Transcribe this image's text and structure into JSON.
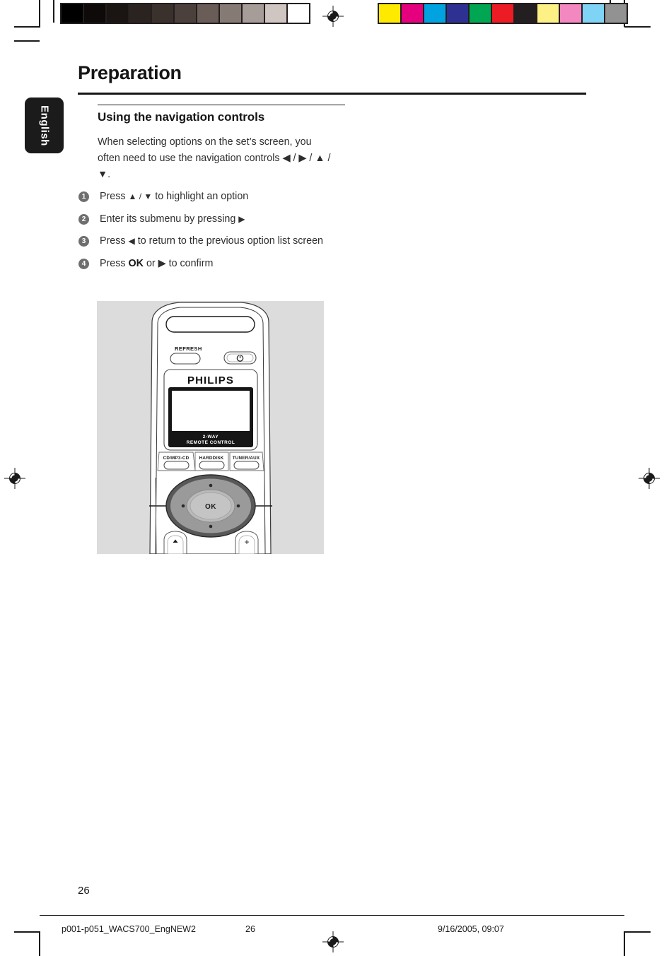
{
  "document": {
    "chapter_title": "Preparation",
    "language_tab": "English",
    "section_heading": "Using the navigation controls",
    "intro_paragraph": "When selecting options on the set’s screen, you often need to use the navigation controls ◀ / ▶ / ▲ / ▼.",
    "page_number": "26"
  },
  "steps": [
    {
      "number": "1",
      "text_before": "Press ",
      "glyphs": "▲ / ▼",
      "text_after": " to highlight an option"
    },
    {
      "number": "2",
      "text_before": "Enter its submenu by pressing ",
      "glyphs": "▶",
      "text_after": ""
    },
    {
      "number": "3",
      "text_before": "Press ",
      "glyphs": "◀",
      "text_after": " to return to the previous option list screen"
    },
    {
      "number": "4",
      "text_before": "Press ",
      "glyphs": "OK",
      "text_after": " or ▶ to confirm"
    }
  ],
  "illustration": {
    "caption_name": "two-way-remote-control",
    "brand": "PHILIPS",
    "display_label_line1": "2-WAY",
    "display_label_line2": "REMOTE CONTROL",
    "refresh_label": "REFRESH",
    "power_icon": "power-standby-icon",
    "source_buttons": [
      "CD/MP3-CD",
      "HARDDISK",
      "TUNER/AUX"
    ],
    "ok_label": "OK",
    "bottom_left_icon": "eject-icon",
    "bottom_right_label": "+",
    "panel_color": "#dcdcdc"
  },
  "footer": {
    "file_name": "p001-p051_WACS700_EngNEW2",
    "page": "26",
    "date_time": "9/16/2005, 09:07"
  },
  "calibration": {
    "grayscale_steps": [
      "#000000",
      "#0d0a09",
      "#1a1512",
      "#2b2320",
      "#3a302c",
      "#4b403b",
      "#6a5d57",
      "#867a74",
      "#a79d98",
      "#cfc6c2",
      "#ffffff"
    ],
    "color_swatches": [
      "#fdea00",
      "#e5007e",
      "#00a3e0",
      "#2e3192",
      "#00a651",
      "#ed1c24",
      "#231f20",
      "#fdf186",
      "#f387c0",
      "#7fd4f5",
      "#929292"
    ]
  }
}
